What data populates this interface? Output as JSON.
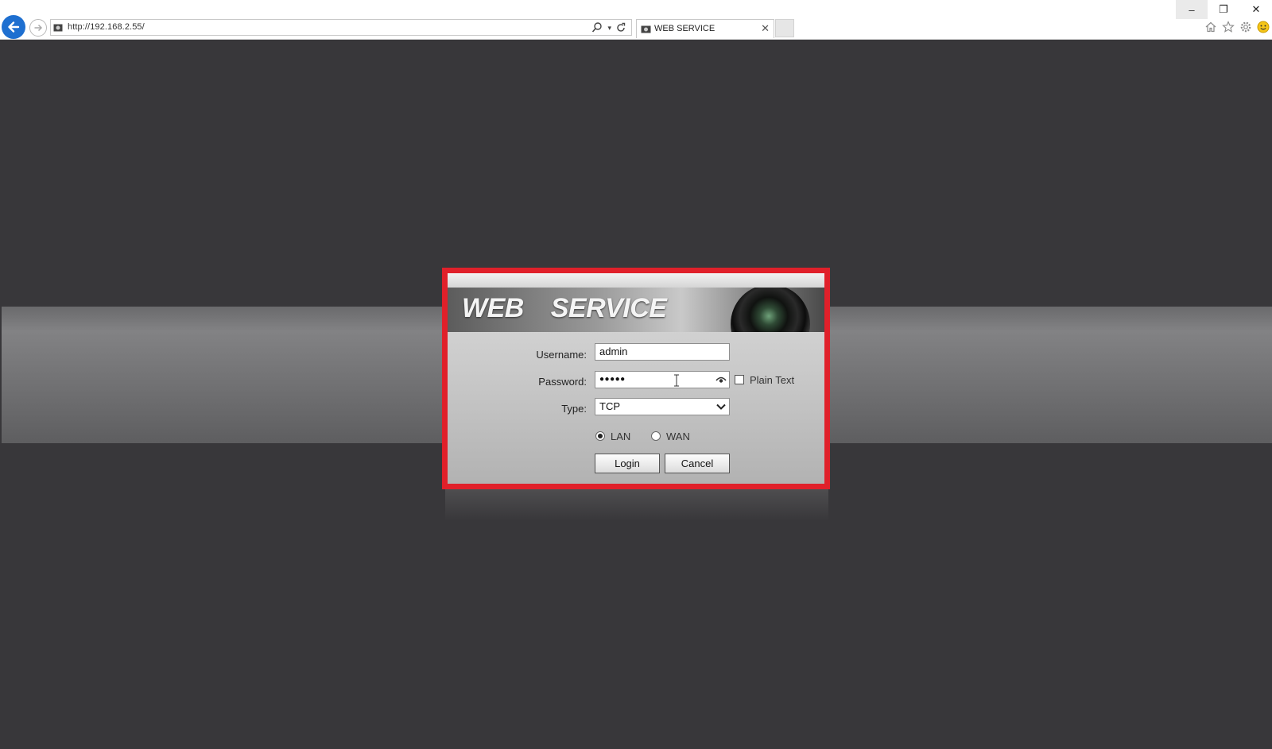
{
  "browser": {
    "url": "http://192.168.2.55/",
    "tab_title": "WEB SERVICE",
    "tab_close": "✕",
    "window_controls": {
      "minimize": "–",
      "restore": "❐",
      "close": "✕"
    },
    "toolbar_icons": [
      "home-icon",
      "favorites-star-icon",
      "settings-gear-icon",
      "smiley-feedback-icon"
    ]
  },
  "login": {
    "banner_title": "WEB  SERVICE",
    "username_label": "Username:",
    "username_value": "admin",
    "password_label": "Password:",
    "password_value": "●●●●●",
    "plain_text_label": "Plain Text",
    "plain_text_checked": false,
    "type_label": "Type:",
    "type_value": "TCP",
    "network_options": [
      {
        "label": "LAN",
        "selected": true
      },
      {
        "label": "WAN",
        "selected": false
      }
    ],
    "login_button": "Login",
    "cancel_button": "Cancel"
  },
  "colors": {
    "highlight_border": "#e0202a",
    "page_background": "#38373a",
    "back_button": "#1e6fd0"
  }
}
